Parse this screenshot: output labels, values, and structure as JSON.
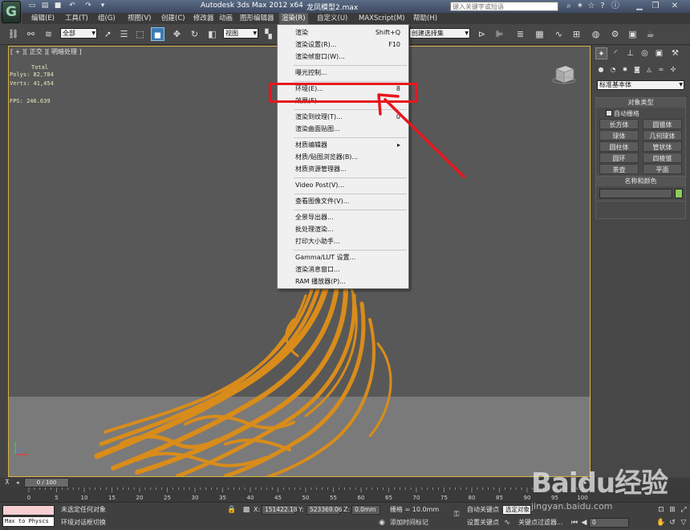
{
  "window": {
    "app_title": "Autodesk 3ds Max  2012 x64",
    "file_name": "龙凤模型2.max",
    "search_placeholder": "键入关键字或短语"
  },
  "menubar": {
    "items": [
      "编辑(E)",
      "工具(T)",
      "组(G)",
      "视图(V)",
      "创建(C)",
      "修改器",
      "动画",
      "图形编辑器",
      "渲染(R)",
      "自定义(U)",
      "MAXScript(M)",
      "帮助(H)"
    ],
    "active_index": 8
  },
  "toolbar": {
    "selection_filter": "全部",
    "reference_coord": "视图",
    "named_selection": "创建选择集"
  },
  "viewport": {
    "label": "[ + ][ 正交 ][ 明暗处理 ]",
    "stats": {
      "total_label": "Total",
      "polys": "Polys: 82,784",
      "verts": "Verts: 41,454",
      "fps": "FPS:    246.639"
    }
  },
  "render_menu": {
    "items": [
      {
        "label": "渲染",
        "shortcut": "Shift+Q"
      },
      {
        "label": "渲染设置(R)...",
        "shortcut": "F10"
      },
      {
        "label": "渲染帧窗口(W)...",
        "shortcut": ""
      },
      {
        "sep": true
      },
      {
        "label": "曝光控制...",
        "shortcut": ""
      },
      {
        "sep": true
      },
      {
        "label": "环境(E)...",
        "shortcut": "8"
      },
      {
        "label": "效果(F)...",
        "shortcut": ""
      },
      {
        "sep": true
      },
      {
        "label": "渲染到纹理(T)...",
        "shortcut": "0"
      },
      {
        "label": "渲染曲面贴图...",
        "shortcut": ""
      },
      {
        "sep": true
      },
      {
        "label": "材质编辑器",
        "shortcut": "▸"
      },
      {
        "label": "材质/贴图浏览器(B)...",
        "shortcut": ""
      },
      {
        "label": "材质资源管理器...",
        "shortcut": ""
      },
      {
        "sep": true
      },
      {
        "label": "Video Post(V)...",
        "shortcut": ""
      },
      {
        "sep": true
      },
      {
        "label": "查看图像文件(V)...",
        "shortcut": ""
      },
      {
        "sep": true
      },
      {
        "label": "全景导出器...",
        "shortcut": ""
      },
      {
        "label": "批处理渲染...",
        "shortcut": ""
      },
      {
        "label": "打印大小助手...",
        "shortcut": ""
      },
      {
        "sep": true
      },
      {
        "label": "Gamma/LUT 设置...",
        "shortcut": ""
      },
      {
        "label": "渲染消息窗口...",
        "shortcut": ""
      },
      {
        "label": "RAM 播放器(P)...",
        "shortcut": ""
      }
    ],
    "highlighted_label": "环境(E)..."
  },
  "command_panel": {
    "category_dropdown": "标准基本体",
    "object_type": {
      "title": "对象类型",
      "autogrid_label": "自动栅格",
      "buttons": [
        "长方体",
        "圆锥体",
        "球体",
        "几何球体",
        "圆柱体",
        "管状体",
        "圆环",
        "四棱锥",
        "茶壶",
        "平面"
      ]
    },
    "name_color": {
      "title": "名称和颜色"
    }
  },
  "timeline": {
    "frame_readout": "0 / 100",
    "ticks": [
      "0",
      "5",
      "10",
      "15",
      "20",
      "25",
      "30",
      "35",
      "40",
      "45",
      "50",
      "55",
      "60",
      "65",
      "70",
      "75",
      "80",
      "85",
      "90",
      "95",
      "100"
    ]
  },
  "statusbar": {
    "maxscript_text": "Max to Physcs (",
    "selection_status": "未选定任何对象",
    "prompt": "环境对话框切换",
    "x_label": "X:",
    "x_value": "151422.18",
    "y_label": "Y:",
    "y_value": "523369.06",
    "z_label": "Z:",
    "z_value": "0.0mm",
    "grid": "栅格 = 10.0mm",
    "add_time_tag": "添加时间标记",
    "auto_key": "自动关键点",
    "set_key": "设置关键点",
    "selected_object": "选定对象",
    "key_filters": "关键点过滤器...",
    "frame": "0"
  },
  "watermark": {
    "brand": "Baidu经验",
    "url": "jingyan.baidu.com"
  },
  "colors": {
    "menu_highlight_box": "#e8161d",
    "arrow": "#e8161d",
    "dragon_orange": "#d98c1a",
    "viewport_border": "#d7b33e"
  }
}
